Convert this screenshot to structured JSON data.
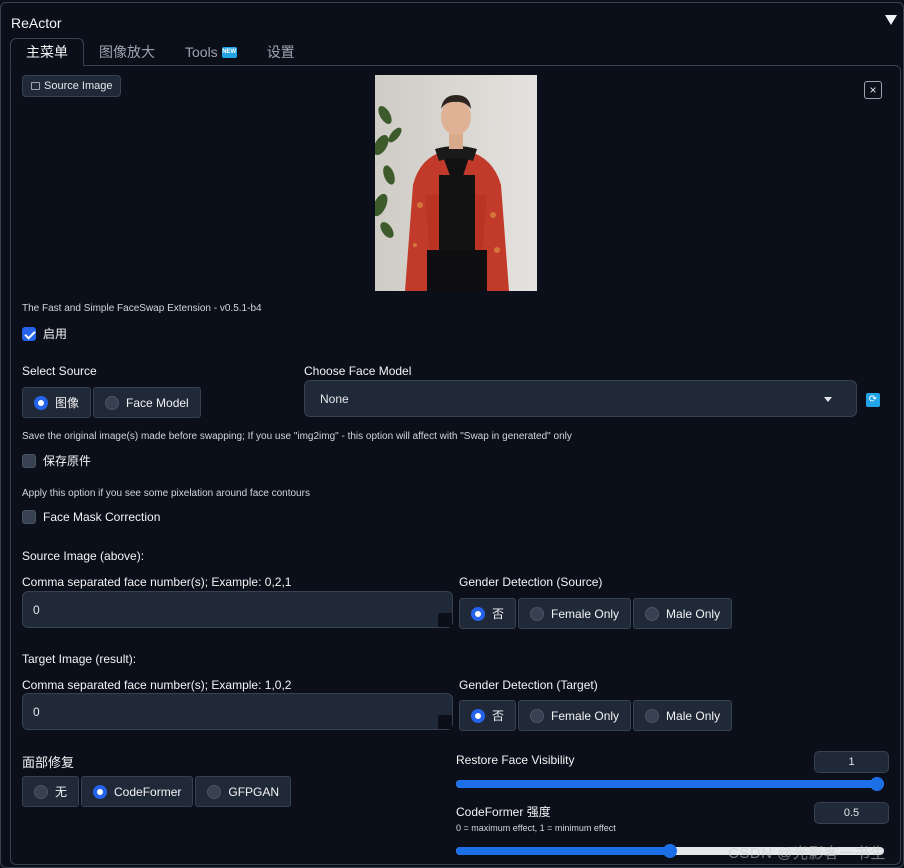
{
  "panel": {
    "title": "ReActor"
  },
  "tabs": [
    {
      "label": "主菜单"
    },
    {
      "label": "图像放大"
    },
    {
      "label": "Tools",
      "badge": "NEW"
    },
    {
      "label": "设置"
    }
  ],
  "source_image": {
    "label": "Source Image",
    "close_glyph": "×"
  },
  "version_text": "The Fast and Simple FaceSwap Extension - v0.5.1-b4",
  "enable": {
    "label": "启用",
    "checked": true
  },
  "select_source": {
    "label": "Select Source",
    "options": [
      "图像",
      "Face Model"
    ],
    "selected": "图像"
  },
  "face_model": {
    "label": "Choose Face Model",
    "value": "None",
    "refresh_glyph": "⟳"
  },
  "save_original": {
    "hint": "Save the original image(s) made before swapping; If you use \"img2img\" - this option will affect with \"Swap in generated\" only",
    "label": "保存原件",
    "checked": false
  },
  "mask_correction": {
    "hint": "Apply this option if you see some pixelation around face contours",
    "label": "Face Mask Correction",
    "checked": false
  },
  "source_section": {
    "heading": "Source Image (above):",
    "faces_label": "Comma separated face number(s); Example: 0,2,1",
    "faces_value": "0",
    "gender_label": "Gender Detection (Source)",
    "gender_options": [
      "否",
      "Female Only",
      "Male Only"
    ],
    "gender_selected": "否"
  },
  "target_section": {
    "heading": "Target Image (result):",
    "faces_label": "Comma separated face number(s); Example: 1,0,2",
    "faces_value": "0",
    "gender_label": "Gender Detection (Target)",
    "gender_options": [
      "否",
      "Female Only",
      "Male Only"
    ],
    "gender_selected": "否"
  },
  "restore_face": {
    "label": "面部修复",
    "options": [
      "无",
      "CodeFormer",
      "GFPGAN"
    ],
    "selected": "CodeFormer"
  },
  "restore_visibility": {
    "label": "Restore Face Visibility",
    "value": "1",
    "fraction": 1.0
  },
  "codeformer_weight": {
    "label": "CodeFormer 强度",
    "hint": "0 = maximum effect, 1 = minimum effect",
    "value": "0.5",
    "fraction": 0.5
  },
  "watermark": "CSDN @光影客一书生",
  "colors": {
    "accent": "#2563eb",
    "background": "#0b0f19",
    "field": "#1f2937",
    "border": "#374151"
  }
}
